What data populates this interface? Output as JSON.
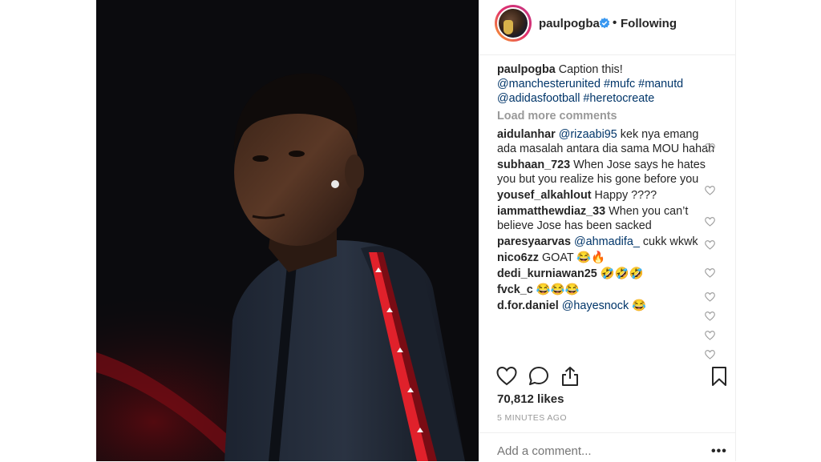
{
  "post": {
    "username": "paulpogba",
    "following_label": "Following",
    "separator": "•",
    "caption_user": "paulpogba",
    "caption_text": "Caption this!",
    "caption_line2": "@manchesterunited #mufc #manutd",
    "caption_line3": "@adidasfootball #heretocreate",
    "load_more": "Load more comments",
    "likes": "70,812 likes",
    "time_ago": "5 MINUTES AGO",
    "add_comment_placeholder": "Add a comment...",
    "more_label": "•••"
  },
  "comments": [
    {
      "user": "aidulanhar",
      "mention": "@rizaabi95",
      "text": " kek nya emang ada masalah antara dia sama MOU hahah"
    },
    {
      "user": "subhaan_723",
      "mention": "",
      "text": " When Jose says he hates you but you realize his gone before you"
    },
    {
      "user": "yousef_alkahlout",
      "mention": "",
      "text": " Happy ????"
    },
    {
      "user": "iammatthewdiaz_33",
      "mention": "",
      "text": " When you can’t believe Jose has been sacked"
    },
    {
      "user": "paresyaarvas",
      "mention": "@ahmadifa_",
      "text": " cukk wkwk"
    },
    {
      "user": "nico6zz",
      "mention": "",
      "text": " GOAT 😂🔥"
    },
    {
      "user": "dedi_kurniawan25",
      "mention": "",
      "text": " 🤣🤣🤣"
    },
    {
      "user": "fvck_c",
      "mention": "",
      "text": " 😂😂😂"
    },
    {
      "user": "d.for.daniel",
      "mention": "@hayesnock",
      "text": " 😂"
    }
  ],
  "colors": {
    "link": "#003569",
    "text": "#262626",
    "muted": "#999999",
    "verified": "#3897f0",
    "photo_bg": "#0b0b0e",
    "jacket_stripe": "#e0212b"
  },
  "icons": {
    "verified": "verified-badge-icon",
    "heart": "heart-outline-icon",
    "comment": "comment-bubble-icon",
    "share": "share-icon",
    "bookmark": "bookmark-icon",
    "more": "more-options-icon"
  }
}
